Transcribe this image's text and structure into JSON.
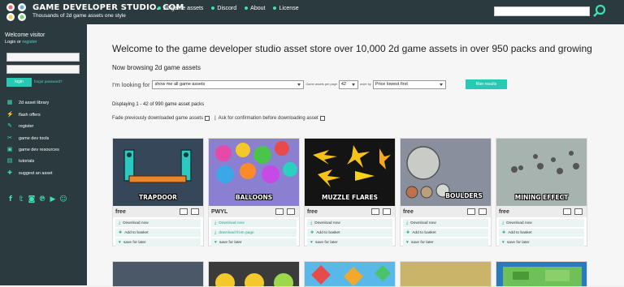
{
  "header": {
    "brand": "GAME DEVELOPER STUDIO. COM",
    "tagline": "Thousands of 2d game assets one style",
    "nav": [
      "2d game assets",
      "Discord",
      "About",
      "License"
    ]
  },
  "sidebar": {
    "welcome": "Welcome visitor",
    "login_text": "Login",
    "or_text": "or",
    "register_text": "register",
    "login_button": "login",
    "forgot_link": "forgot password?",
    "items": [
      {
        "icon": "grid-icon",
        "label": "2d asset library"
      },
      {
        "icon": "flash-icon",
        "label": "flash offers"
      },
      {
        "icon": "register-icon",
        "label": "register"
      },
      {
        "icon": "tools-icon",
        "label": "game dev tools"
      },
      {
        "icon": "resources-icon",
        "label": "game dev resources"
      },
      {
        "icon": "tutorials-icon",
        "label": "tutorials"
      },
      {
        "icon": "suggest-icon",
        "label": "suggest an asset"
      }
    ],
    "social": [
      "f",
      "t",
      "ig",
      "p",
      "yt",
      "dc"
    ]
  },
  "main": {
    "headline": "Welcome to the game developer studio asset store over 10,000 2d game assets in over 950 packs and growing",
    "browsing": "Now browsing 2d game assets",
    "looking_label": "I'm looking for",
    "looking_value": "show me all game assets",
    "per_page_label": "Game assets per page",
    "per_page_value": "42",
    "order_label": "order by",
    "order_value": "Price lowest first",
    "filter_button": "filter results",
    "displaying": "Displaying 1 - 42 of 990 game asset packs",
    "fade_label": "Fade previously downloaded game assets",
    "separator": "|",
    "confirm_label": "Ask for confirmation before downloading asset",
    "cards": [
      {
        "title": "TRAPDOOR",
        "price": "free",
        "a1": "Download now",
        "a2": "Add to basket",
        "a3": "save for later"
      },
      {
        "title": "BALLOONS",
        "price": "PWYL",
        "a1": "Download now",
        "a2": "download from page",
        "a3": "save for later"
      },
      {
        "title": "MUZZLE FLARES",
        "price": "free",
        "a1": "Download now",
        "a2": "Add to basket",
        "a3": "save for later"
      },
      {
        "title": "BOULDERS",
        "price": "free",
        "a1": "Download now",
        "a2": "Add to basket",
        "a3": "save for later"
      },
      {
        "title": "MINING EFFECT",
        "price": "free",
        "a1": "Download now",
        "a2": "Add to basket",
        "a3": "save for later"
      }
    ]
  },
  "colors": {
    "dark": "#2b3a3e",
    "accent": "#27c9b2"
  }
}
